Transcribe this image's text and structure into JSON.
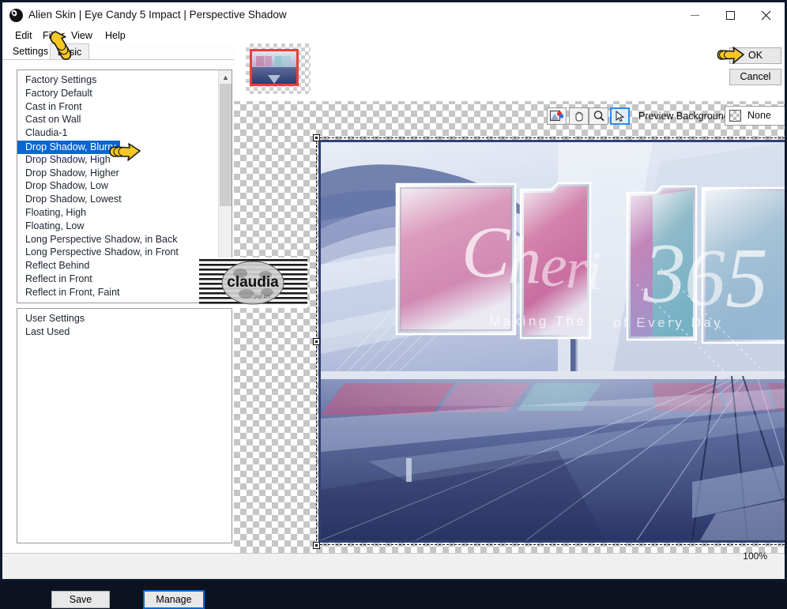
{
  "window": {
    "title": "Alien Skin | Eye Candy 5 Impact | Perspective Shadow",
    "icon": "alien-skin-logo-icon",
    "minimize": "–",
    "maximize": "□",
    "close": "✕"
  },
  "menu": {
    "items": [
      {
        "label": "Edit"
      },
      {
        "label": "Filter"
      },
      {
        "label": "View"
      },
      {
        "label": "Help"
      }
    ]
  },
  "tabs": [
    {
      "label": "Settings",
      "active": true
    },
    {
      "label": "Basic",
      "active": false
    }
  ],
  "factory_list": {
    "items": [
      "Factory Settings",
      "Factory Default",
      "Cast in Front",
      "Cast on Wall",
      "Claudia-1",
      "Drop Shadow, Blurry",
      "Drop Shadow, High",
      "Drop Shadow, Higher",
      "Drop Shadow, Low",
      "Drop Shadow, Lowest",
      "Floating, High",
      "Floating, Low",
      "Long Perspective Shadow, in Back",
      "Long Perspective Shadow, in Front",
      "Reflect Behind",
      "Reflect in Front",
      "Reflect in Front, Faint"
    ],
    "selected": "Drop Shadow, Blurry",
    "selected_index": 5
  },
  "user_list": {
    "items": [
      "User Settings",
      "Last Used"
    ]
  },
  "buttons": {
    "save": "Save",
    "manage": "Manage",
    "ok": "OK",
    "cancel": "Cancel"
  },
  "preview_toolbar": {
    "tools": [
      {
        "name": "preview-compare-icon",
        "active": false
      },
      {
        "name": "hand-pan-icon",
        "active": false
      },
      {
        "name": "magnifier-zoom-icon",
        "active": false
      },
      {
        "name": "arrow-select-icon",
        "active": true
      }
    ],
    "background_label": "Preview Background:",
    "background_value": "None",
    "caret": "⌵"
  },
  "status": {
    "zoom": "100%"
  },
  "preview_image": {
    "headline": "Cheri",
    "number": "365",
    "tagline": "Making The ... of Every Day"
  },
  "watermark": {
    "text": "claudia"
  },
  "colors": {
    "selection_blue": "#0b67d0",
    "focus_blue": "#2b8ae8",
    "thumb_outline_red": "#ef3b3b",
    "preview_border": "#2f3f77",
    "window_border": "#10182c"
  }
}
